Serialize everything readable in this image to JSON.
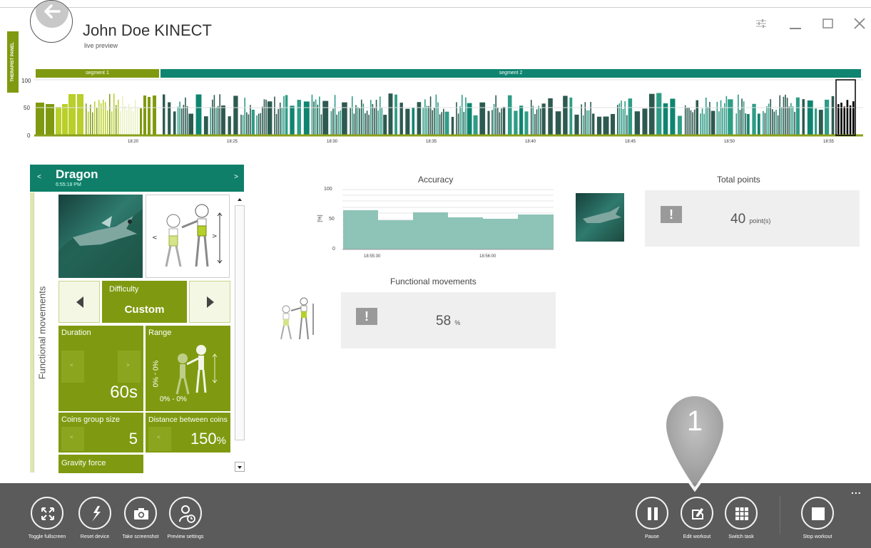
{
  "header": {
    "title": "John Doe KINECT",
    "subtitle": "live preview",
    "side_tab": "THERAPIST PANEL",
    "window_controls": [
      "settings-icon",
      "minimize-icon",
      "maximize-icon",
      "close-icon"
    ]
  },
  "timeline": {
    "segments": [
      "segment 1",
      "segment 2"
    ],
    "y_labels": [
      "100",
      "50",
      "0"
    ],
    "time_labels": [
      "18:20",
      "18:25",
      "18:30",
      "18:35",
      "18:40",
      "18:45",
      "18:50",
      "18:55"
    ],
    "colors": {
      "lime": "#b9cf2a",
      "olive": "#7f9a10",
      "darkteal": "#2d5a50",
      "teal": "#0f8470",
      "midteal": "#2f9c86",
      "gray": "#888888",
      "black": "#000000"
    }
  },
  "task": {
    "name": "Dragon",
    "time": "6:55:18 PM",
    "side_label": "Functional movements",
    "difficulty_label": "Difficulty",
    "difficulty_value": "Custom",
    "tiles": {
      "duration_label": "Duration",
      "duration_value": "60s",
      "range_label": "Range",
      "range_value": "0% - 0%",
      "range_vertical": "%0 - %0",
      "coins_label": "Coins group size",
      "coins_value": "5",
      "distance_label": "Distance between coins",
      "distance_value": "150",
      "distance_unit": "%",
      "gravity_label": "Gravity force"
    }
  },
  "accuracy": {
    "title": "Accuracy",
    "y_ticks": [
      "100",
      "50",
      "0"
    ],
    "y_unit": "[%]",
    "x_ticks": [
      "18:55:30",
      "18:56:00"
    ]
  },
  "functional_movements": {
    "title": "Functional movements",
    "value": "58",
    "unit": "%"
  },
  "total_points": {
    "title": "Total points",
    "value": "40",
    "unit": "point(s)"
  },
  "callout": {
    "number": "1"
  },
  "bottom_bar": {
    "left_buttons": [
      {
        "label": "Toggle fullscreen",
        "icon": "fullscreen-icon"
      },
      {
        "label": "Reset device",
        "icon": "reset-device-icon"
      },
      {
        "label": "Take screenshot",
        "icon": "camera-icon"
      },
      {
        "label": "Preview settings",
        "icon": "preview-settings-icon"
      }
    ],
    "right_buttons": [
      {
        "label": "Pause",
        "icon": "pause-icon"
      },
      {
        "label": "Edit workout",
        "icon": "edit-workout-icon"
      },
      {
        "label": "Switch task",
        "icon": "grid-icon"
      },
      {
        "label": "Stop workout",
        "icon": "stop-icon"
      }
    ],
    "more": "..."
  }
}
